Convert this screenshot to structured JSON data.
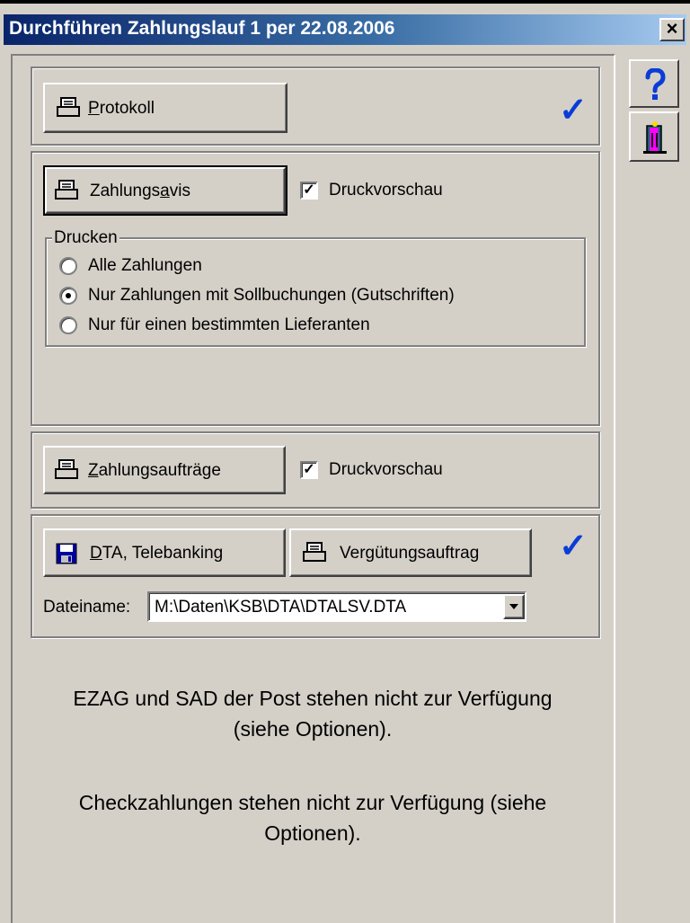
{
  "window": {
    "title": "Durchführen Zahlungslauf 1 per 22.08.2006",
    "close_label": "×"
  },
  "protokoll": {
    "button_prefix": "P",
    "button_rest": "rotokoll",
    "done_mark": "✓"
  },
  "zahlungsavis": {
    "button_prefix": "Zahlungs",
    "button_mnemonic": "a",
    "button_rest": "vis",
    "preview_label": "Druckvorschau",
    "preview_checked": true,
    "group_title": "Drucken",
    "options": [
      {
        "label": "Alle Zahlungen",
        "selected": false
      },
      {
        "label": "Nur Zahlungen mit Sollbuchungen (Gutschriften)",
        "selected": true
      },
      {
        "label": "Nur für einen bestimmten Lieferanten",
        "selected": false
      }
    ]
  },
  "zahlungsauftraege": {
    "button_mnemonic": "Z",
    "button_rest": "ahlungsaufträge",
    "preview_label": "Druckvorschau",
    "preview_checked": true
  },
  "dta": {
    "button_mnemonic": "D",
    "button_rest": "TA, Telebanking",
    "verguetung_label": "Vergütungsauftrag",
    "done_mark": "✓",
    "filename_label": "Dateiname:",
    "filename_value": "M:\\Daten\\KSB\\DTA\\DTALSV.DTA"
  },
  "info": {
    "ezag_line1": "EZAG und SAD der Post stehen nicht zur Verfügung",
    "ezag_line2": "(siehe Optionen).",
    "check_line1": "Checkzahlungen stehen nicht zur Verfügung (siehe",
    "check_line2": "Optionen)."
  },
  "sidebar": {
    "help_icon": "question-mark-icon",
    "exit_icon": "exit-door-icon"
  },
  "colors": {
    "accent_check": "#0a3cd8",
    "title_start": "#0a246a",
    "title_end": "#a6caf0"
  }
}
